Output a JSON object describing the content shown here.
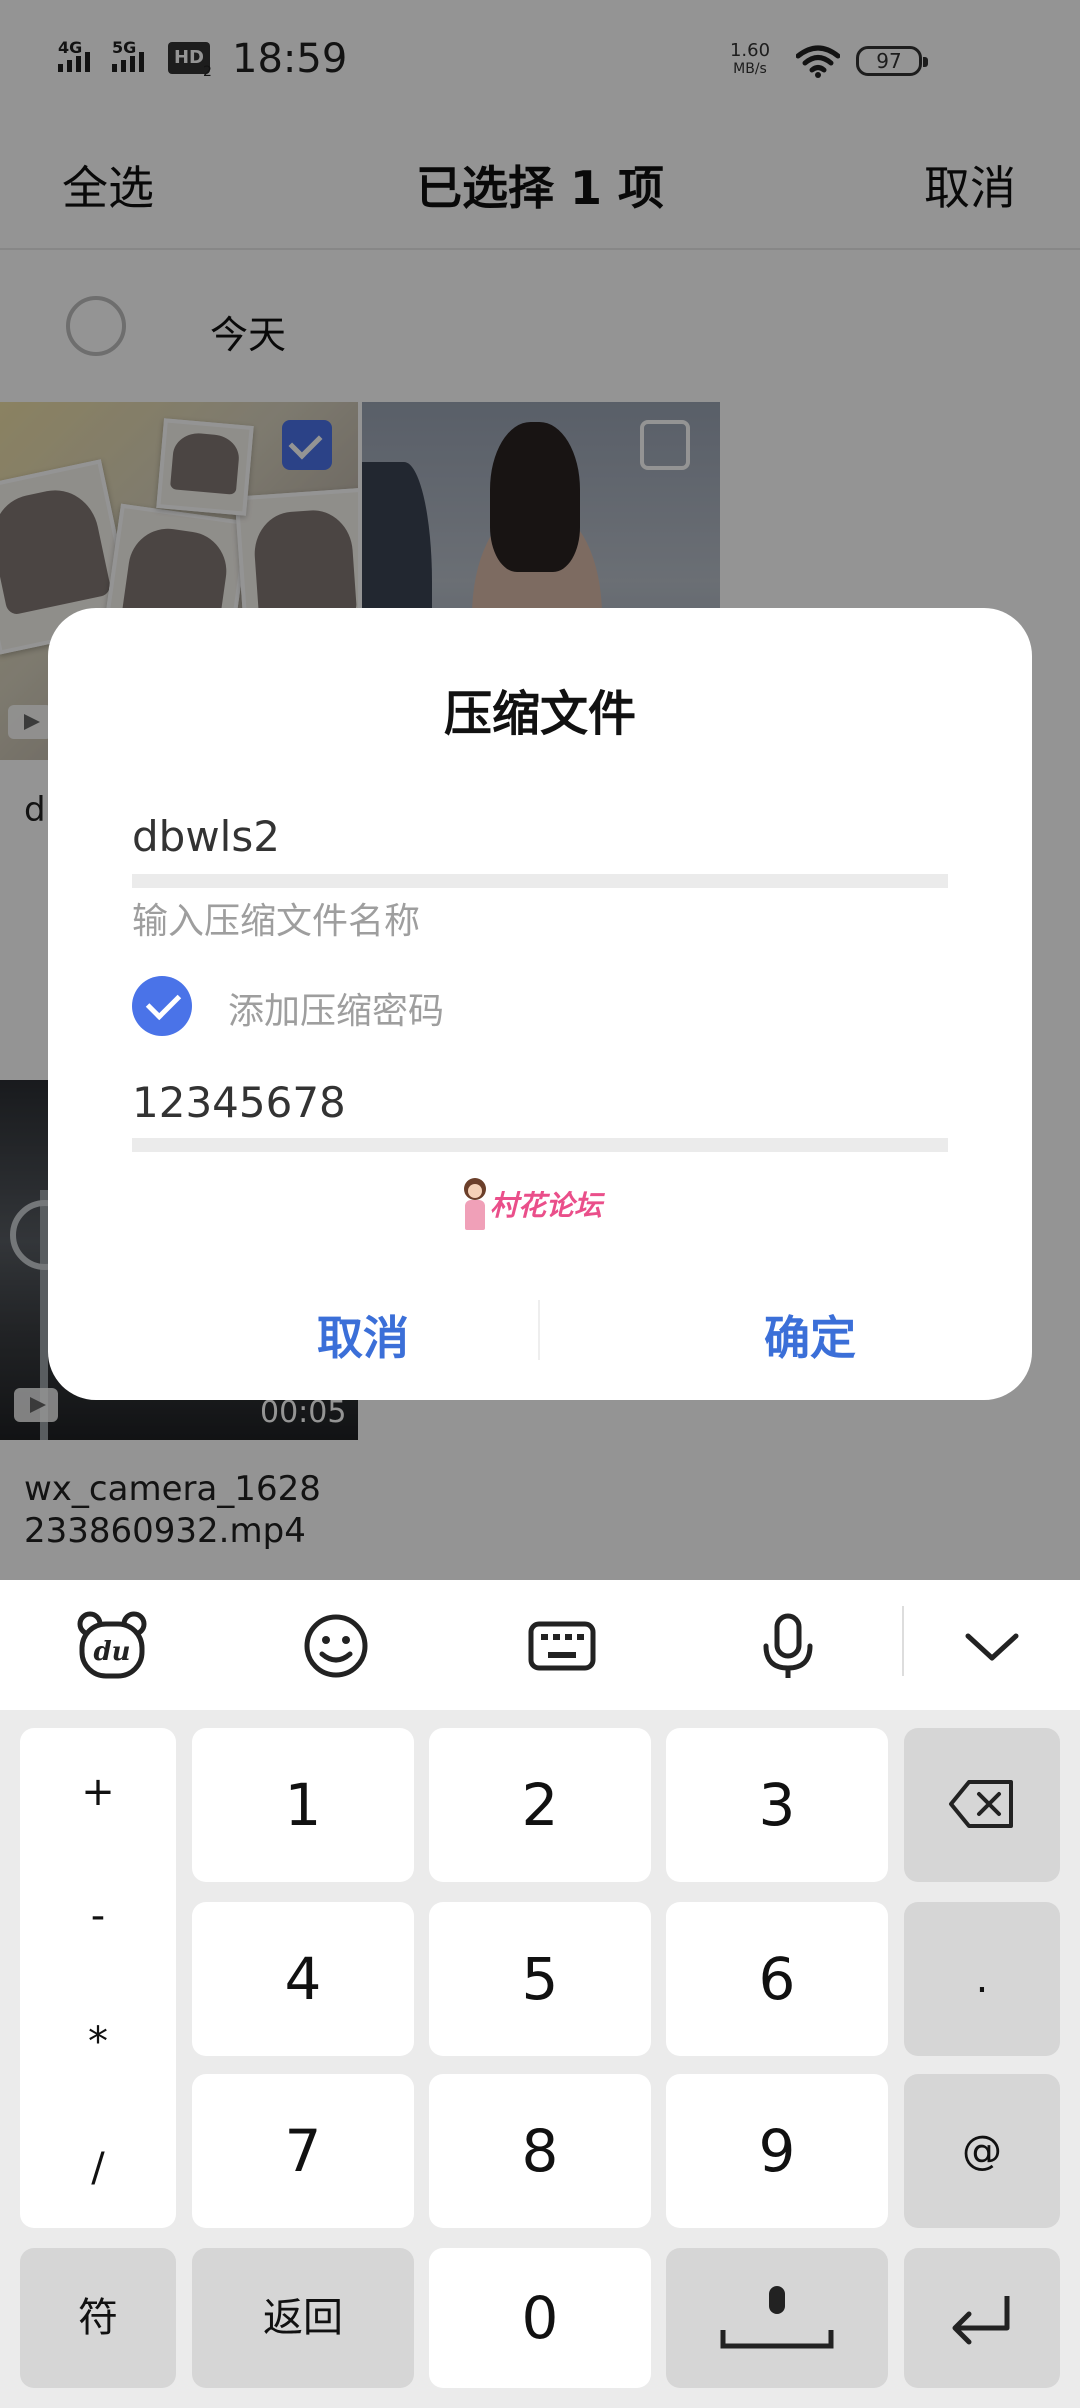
{
  "status_bar": {
    "net1": "4G",
    "net2": "5G",
    "hd": "HD",
    "hd_sub": "2",
    "time": "18:59",
    "speed_value": "1.60",
    "speed_unit": "MB/s",
    "battery": "97"
  },
  "topbar": {
    "select_all": "全选",
    "title": "已选择 1 项",
    "cancel": "取消"
  },
  "group": {
    "label": "今天"
  },
  "files": {
    "partial_name": "d",
    "video_duration": "00:05",
    "video_name_line1": "wx_camera_1628",
    "video_name_line2": "233860932.mp4"
  },
  "dialog": {
    "title": "压缩文件",
    "filename_value": "dbwls2",
    "filename_hint": "输入压缩文件名称",
    "password_checkbox_label": "添加压缩密码",
    "password_checked": true,
    "password_value": "12345678",
    "watermark": "村花论坛",
    "cancel": "取消",
    "confirm": "确定"
  },
  "keyboard": {
    "toolbar_icons": [
      "du-logo-icon",
      "emoji-icon",
      "keyboard-icon",
      "microphone-icon",
      "chevron-down-icon"
    ],
    "symbols": [
      "+",
      "-",
      "*",
      "/"
    ],
    "digits": [
      "1",
      "2",
      "3",
      "4",
      "5",
      "6",
      "7",
      "8",
      "9"
    ],
    "right_keys": {
      "dot": ".",
      "at": "@"
    },
    "bottom": {
      "fu": "符",
      "back": "返回",
      "zero": "0"
    },
    "colors": {
      "accent": "#4a73e8",
      "key_bg": "#ffffff",
      "key_gray": "#d6d6d6",
      "board_bg": "#ebebeb"
    }
  }
}
